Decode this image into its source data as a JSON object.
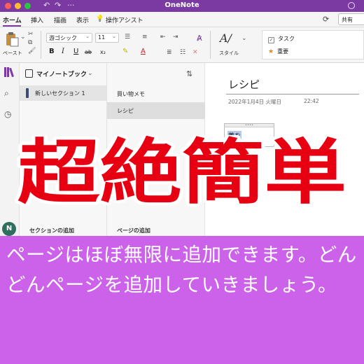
{
  "window": {
    "title": "OneNote",
    "colors": {
      "brand": "#7a3aa2",
      "caption_bg": "#cd62ea",
      "banner_text": "#e60012"
    }
  },
  "titlebar_icons": {
    "undo": "undo-icon",
    "redo": "redo-icon",
    "more": "···"
  },
  "tabs": [
    {
      "label": "ホーム",
      "active": true
    },
    {
      "label": "挿入"
    },
    {
      "label": "描画"
    },
    {
      "label": "表示"
    },
    {
      "label": "操作アシスト"
    }
  ],
  "share_label": "共有",
  "ribbon": {
    "paste_label": "ペースト",
    "font_name": "游ゴシック",
    "font_size": "11",
    "format_buttons": [
      "B",
      "I",
      "U",
      "ab",
      "x₂"
    ],
    "style_label": "スタイル",
    "tags": [
      {
        "label": "タスク",
        "icon": "checkbox-icon"
      },
      {
        "label": "重要",
        "icon": "star-icon"
      }
    ]
  },
  "rail": {
    "avatar_initial": "N"
  },
  "notebook": {
    "title": "マイノートブック",
    "sections": [
      {
        "label": "新しいセクション 1",
        "selected": true
      }
    ],
    "add_section_label": "セクションの追加"
  },
  "pages": {
    "items": [
      {
        "label": "買い物メモ",
        "selected": false
      },
      {
        "label": "レシピ",
        "selected": true
      }
    ],
    "add_page_label": "ページの追加"
  },
  "note": {
    "title": "レシピ",
    "date": "2022年1月4日 火曜日",
    "time": "22:42",
    "text": "蓋を"
  },
  "overlay": {
    "banner": "超絶簡単"
  },
  "caption": "ページはほぼ無限に追加できます。どんどんページを追加していきましょう。"
}
